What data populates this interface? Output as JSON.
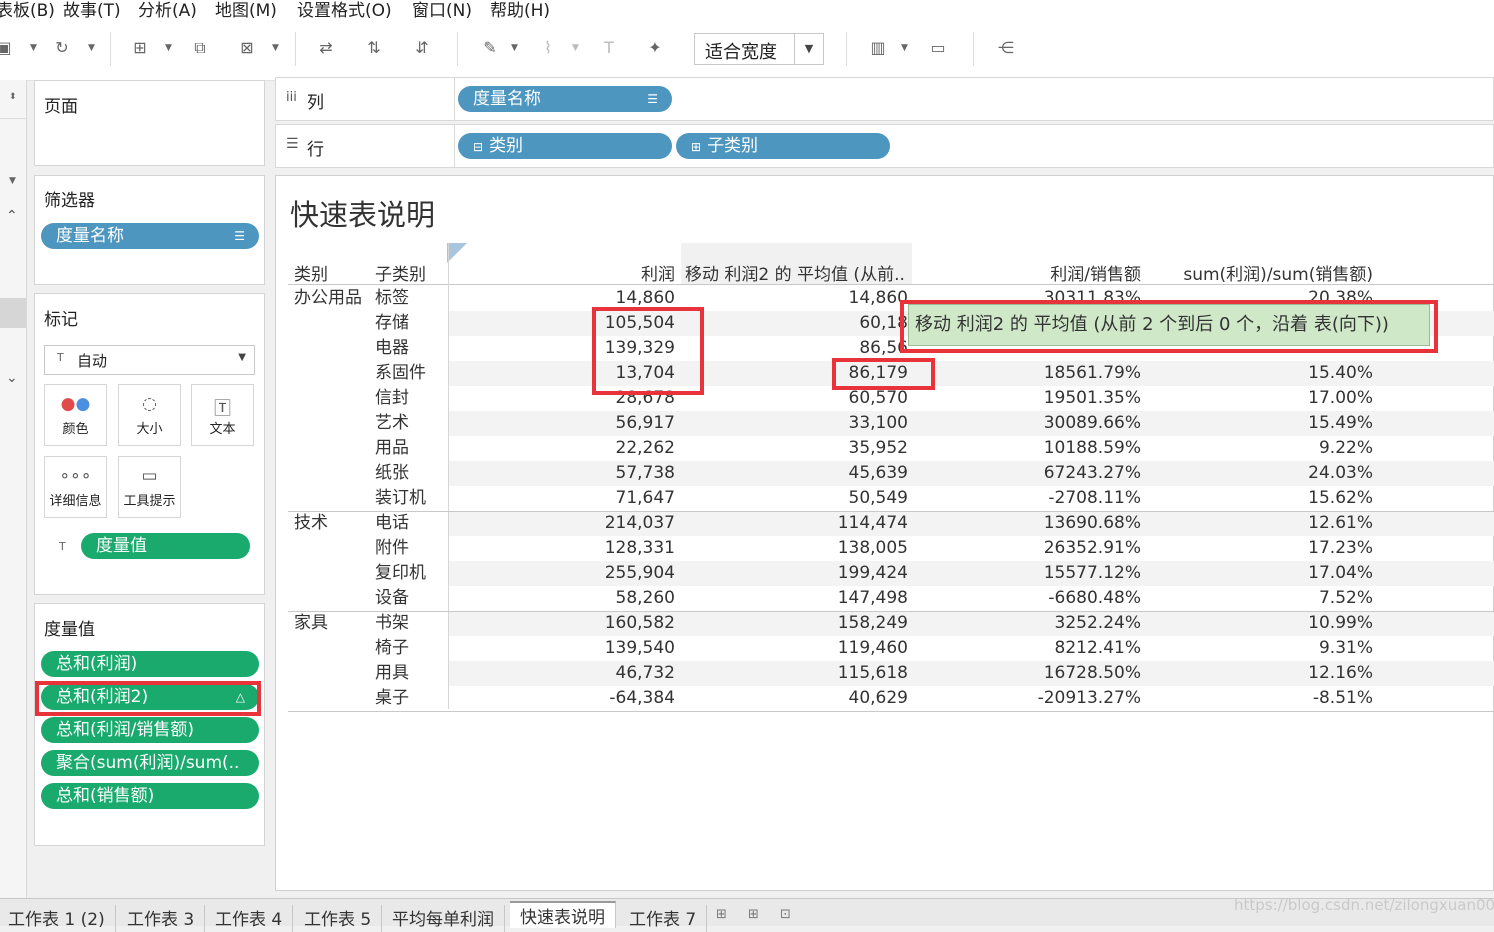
{
  "menu": [
    "表板(B)",
    "故事(T)",
    "分析(A)",
    "地图(M)",
    "设置格式(O)",
    "窗口(N)",
    "帮助(H)"
  ],
  "toolbar": {
    "fit_label": "适合宽度"
  },
  "shelves": {
    "columns_label": "列",
    "rows_label": "行",
    "columns_pill": "度量名称",
    "rows_pills": [
      "类别",
      "子类别"
    ]
  },
  "cards": {
    "pages": "页面",
    "filters": "筛选器",
    "filter_pill": "度量名称",
    "marks": "标记",
    "mark_type": "自动",
    "mark_buttons": [
      "颜色",
      "大小",
      "文本",
      "详细信息",
      "工具提示"
    ],
    "mark_value_pill": "度量值",
    "measure_values": "度量值",
    "measure_pills": [
      "总和(利润)",
      "总和(利润2)",
      "总和(利润/销售额)",
      "聚合(sum(利润)/sum(..",
      "总和(销售额)"
    ]
  },
  "viz": {
    "title": "快速表说明",
    "headers": [
      "类别",
      "子类别",
      "利润",
      "移动 利润2 的 平均值 (从前..",
      "利润/销售额",
      "sum(利润)/sum(销售额)"
    ],
    "rows": [
      {
        "cat": "办公用品",
        "sub": "标签",
        "profit": "14,860",
        "moving": "14,860",
        "ratio": "30311.83%",
        "agg": "20.38%"
      },
      {
        "cat": "",
        "sub": "存储",
        "profit": "105,504",
        "moving": "60,18",
        "ratio": "",
        "agg": ""
      },
      {
        "cat": "",
        "sub": "电器",
        "profit": "139,329",
        "moving": "86,56",
        "ratio": "",
        "agg": ""
      },
      {
        "cat": "",
        "sub": "系固件",
        "profit": "13,704",
        "moving": "86,179",
        "ratio": "18561.79%",
        "agg": "15.40%"
      },
      {
        "cat": "",
        "sub": "信封",
        "profit": "28,678",
        "moving": "60,570",
        "ratio": "19501.35%",
        "agg": "17.00%"
      },
      {
        "cat": "",
        "sub": "艺术",
        "profit": "56,917",
        "moving": "33,100",
        "ratio": "30089.66%",
        "agg": "15.49%"
      },
      {
        "cat": "",
        "sub": "用品",
        "profit": "22,262",
        "moving": "35,952",
        "ratio": "10188.59%",
        "agg": "9.22%"
      },
      {
        "cat": "",
        "sub": "纸张",
        "profit": "57,738",
        "moving": "45,639",
        "ratio": "67243.27%",
        "agg": "24.03%"
      },
      {
        "cat": "",
        "sub": "装订机",
        "profit": "71,647",
        "moving": "50,549",
        "ratio": "-2708.11%",
        "agg": "15.62%"
      },
      {
        "cat": "技术",
        "sub": "电话",
        "profit": "214,037",
        "moving": "114,474",
        "ratio": "13690.68%",
        "agg": "12.61%"
      },
      {
        "cat": "",
        "sub": "附件",
        "profit": "128,331",
        "moving": "138,005",
        "ratio": "26352.91%",
        "agg": "17.23%"
      },
      {
        "cat": "",
        "sub": "复印机",
        "profit": "255,904",
        "moving": "199,424",
        "ratio": "15577.12%",
        "agg": "17.04%"
      },
      {
        "cat": "",
        "sub": "设备",
        "profit": "58,260",
        "moving": "147,498",
        "ratio": "-6680.48%",
        "agg": "7.52%"
      },
      {
        "cat": "家具",
        "sub": "书架",
        "profit": "160,582",
        "moving": "158,249",
        "ratio": "3252.24%",
        "agg": "10.99%"
      },
      {
        "cat": "",
        "sub": "椅子",
        "profit": "139,540",
        "moving": "119,460",
        "ratio": "8212.41%",
        "agg": "9.31%"
      },
      {
        "cat": "",
        "sub": "用具",
        "profit": "46,732",
        "moving": "115,618",
        "ratio": "16728.50%",
        "agg": "12.16%"
      },
      {
        "cat": "",
        "sub": "桌子",
        "profit": "-64,384",
        "moving": "40,629",
        "ratio": "-20913.27%",
        "agg": "-8.51%"
      }
    ],
    "tooltip": "移动 利润2 的 平均值 (从前 2 个到后 0 个，沿着 表(向下))"
  },
  "tabs": [
    "工作表 1 (2)",
    "工作表 3",
    "工作表 4",
    "工作表 5",
    "平均每单利润",
    "快速表说明",
    "工作表 7"
  ],
  "active_tab": "快速表说明",
  "watermark": "https://blog.csdn.net/zilongxuan008"
}
